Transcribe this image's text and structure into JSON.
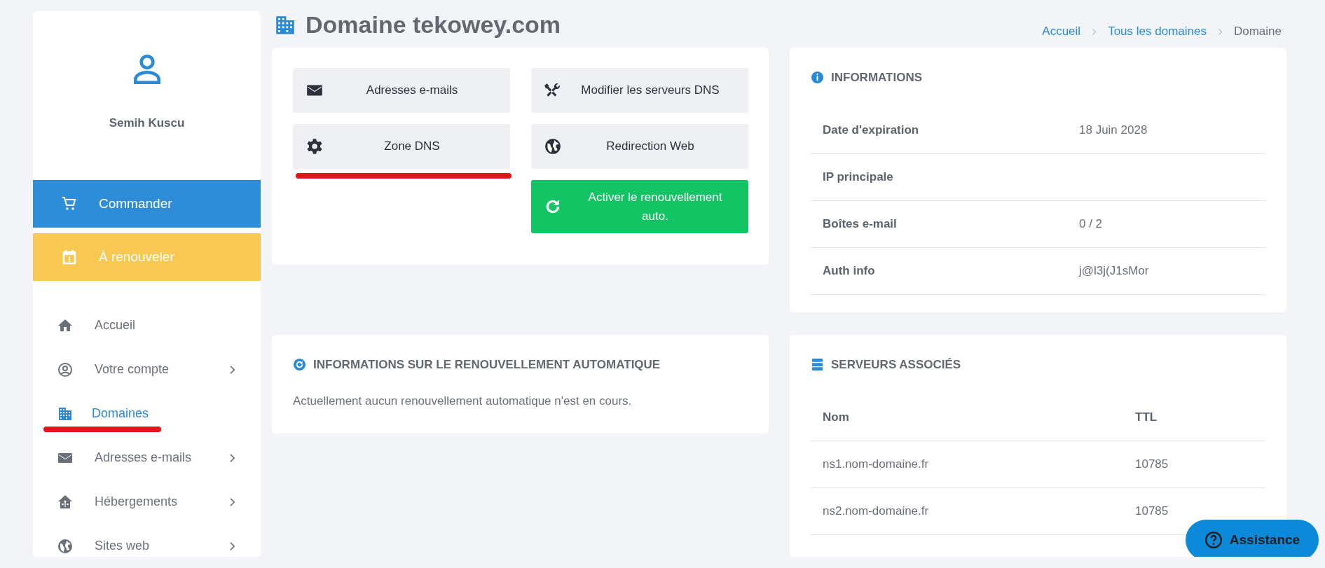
{
  "user": {
    "name": "Semih Kuscu"
  },
  "actions": [
    {
      "label": "Commander",
      "kind": "order"
    },
    {
      "label": "À renouveler",
      "kind": "renew"
    }
  ],
  "nav": [
    {
      "label": "Accueil",
      "selected": false,
      "has_submenu": false,
      "underlined": false
    },
    {
      "label": "Votre compte",
      "selected": false,
      "has_submenu": true,
      "underlined": false
    },
    {
      "label": "Domaines",
      "selected": true,
      "has_submenu": false,
      "underlined": true
    },
    {
      "label": "Adresses e-mails",
      "selected": false,
      "has_submenu": true,
      "underlined": false
    },
    {
      "label": "Hébergements",
      "selected": false,
      "has_submenu": true,
      "underlined": false
    },
    {
      "label": "Sites web",
      "selected": false,
      "has_submenu": true,
      "underlined": false
    }
  ],
  "page": {
    "title": "Domaine tekowey.com"
  },
  "breadcrumb": [
    {
      "label": "Accueil",
      "kind": "link"
    },
    {
      "label": "Tous les domaines",
      "kind": "link"
    },
    {
      "label": "Domaine",
      "kind": "current"
    }
  ],
  "tools": [
    {
      "label": "Adresses e-mails",
      "kind": "plain",
      "underlined": false
    },
    {
      "label": "Modifier les serveurs DNS",
      "kind": "plain",
      "underlined": false
    },
    {
      "label": "Zone DNS",
      "kind": "plain",
      "underlined": true
    },
    {
      "label": "Redirection Web",
      "kind": "plain",
      "underlined": false
    },
    {
      "label": "Activer le renouvellement auto.",
      "kind": "primary",
      "underlined": false
    }
  ],
  "informations": {
    "title": "INFORMATIONS",
    "rows": [
      {
        "label": "Date d'expiration",
        "value": "18 Juin 2028"
      },
      {
        "label": "IP principale"
      },
      {
        "label": "Boîtes e-mail",
        "value": "0 / 2"
      },
      {
        "label": "Auth info",
        "value": "j@l3j(J1sMor"
      }
    ]
  },
  "renewal": {
    "title": "INFORMATIONS SUR LE RENOUVELLEMENT AUTOMATIQUE",
    "text": "Actuellement aucun renouvellement automatique n'est en cours."
  },
  "servers": {
    "title": "SERVEURS ASSOCIÉS",
    "columns": [
      "Nom",
      "TTL"
    ],
    "rows": [
      [
        "ns1.nom-domaine.fr",
        "10785"
      ],
      [
        "ns2.nom-domaine.fr",
        "10785"
      ]
    ]
  },
  "assistance": {
    "label": "Assistance"
  }
}
